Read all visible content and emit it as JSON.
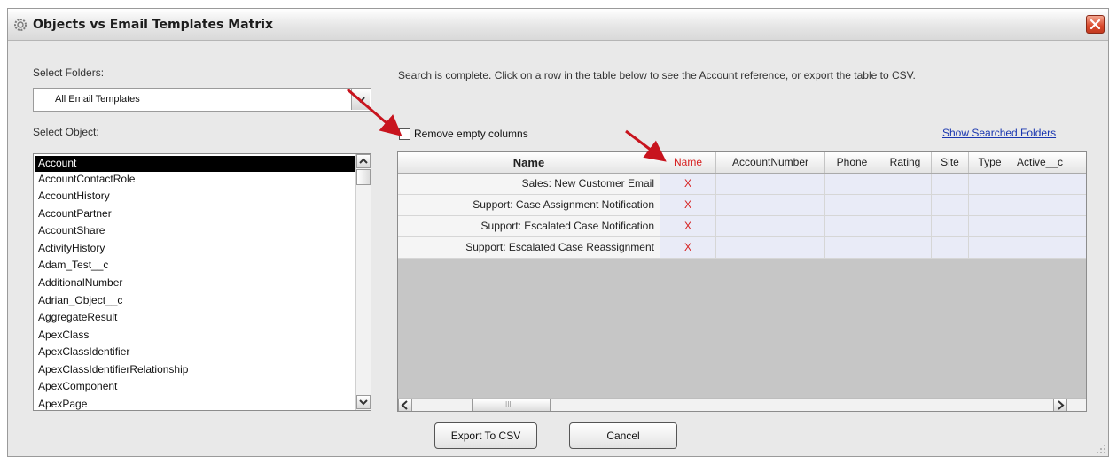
{
  "window": {
    "title": "Objects vs Email Templates Matrix"
  },
  "folders": {
    "label": "Select Folders:",
    "selected": "All Email Templates"
  },
  "objects": {
    "label": "Select Object:",
    "items": [
      "Account",
      "AccountContactRole",
      "AccountHistory",
      "AccountPartner",
      "AccountShare",
      "ActivityHistory",
      "Adam_Test__c",
      "AdditionalNumber",
      "Adrian_Object__c",
      "AggregateResult",
      "ApexClass",
      "ApexClassIdentifier",
      "ApexClassIdentifierRelationship",
      "ApexComponent",
      "ApexPage"
    ],
    "selected_index": 0
  },
  "status_message": "Search is complete. Click on a row in the table below to see the Account reference, or export the table to CSV.",
  "remove_empty_columns": {
    "label": "Remove empty columns",
    "checked": false
  },
  "show_searched_folders": "Show Searched Folders",
  "table": {
    "columns": [
      "Name",
      "Name",
      "AccountNumber",
      "Phone",
      "Rating",
      "Site",
      "Type",
      "Active__c"
    ],
    "rows": [
      {
        "name": "Sales: New Customer Email",
        "cells": [
          "X",
          "",
          "",
          "",
          "",
          "",
          ""
        ]
      },
      {
        "name": "Support: Case Assignment Notification",
        "cells": [
          "X",
          "",
          "",
          "",
          "",
          "",
          ""
        ]
      },
      {
        "name": "Support: Escalated Case Notification",
        "cells": [
          "X",
          "",
          "",
          "",
          "",
          "",
          ""
        ]
      },
      {
        "name": "Support: Escalated Case Reassignment",
        "cells": [
          "X",
          "",
          "",
          "",
          "",
          "",
          ""
        ]
      }
    ],
    "scroll_grip": "III"
  },
  "buttons": {
    "export": "Export To CSV",
    "cancel": "Cancel"
  },
  "colors": {
    "accent_red": "#d62020",
    "link_blue": "#1a37b0",
    "selection": "#000000",
    "annotation_arrow": "#c8141e"
  },
  "icons": [
    "gear-icon",
    "close-icon",
    "dropdown-arrow-icon",
    "scroll-up-icon",
    "scroll-down-icon",
    "scroll-left-icon",
    "scroll-right-icon",
    "resize-grip-icon"
  ]
}
